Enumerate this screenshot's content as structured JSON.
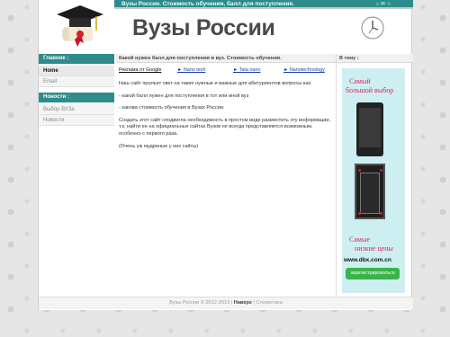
{
  "header": {
    "slogan": "Вузы России. Стоимость обучения, балл для поступления.",
    "title": "Вузы России",
    "top_icons": "⌂ ✉ ☆"
  },
  "sidebar": {
    "main_heading": "Главное :",
    "main_items": [
      {
        "label": "Home",
        "active": true
      },
      {
        "label": "Email",
        "active": false
      }
    ],
    "news_heading": "Новости :",
    "news_items": [
      {
        "label": "Выбор ВУЗа"
      },
      {
        "label": "Новости"
      }
    ]
  },
  "main": {
    "heading": "Какой нужен балл для поступления в вуз. Стоимость обучения.",
    "ad_label": "Реклама от Google",
    "links": [
      "► Nano tech",
      "► Tata nano",
      "► Nanotechnology"
    ],
    "paragraphs": [
      "Наш сайт прольет свет на такие нужные и важные для абитуриентов вопросы как:",
      "- какой балл нужен для поступления в тот или иной вуз",
      "- какова стоимость обучения в Вузах России.",
      "Создать этот сайт сподвигла необходимость в простом виде разместить эту информации, т.к. найти ее на официальных сайтах Вузов не всегда представляется возможным, особенно с первого раза.",
      "(Очень уж мудреные у них сайты)"
    ]
  },
  "right": {
    "heading": "В тему :",
    "ad": {
      "line1": "Самый",
      "line2": "большой выбор",
      "line3": "Самые",
      "line4": "низкие цены",
      "url": "www.dbx.com.cn",
      "button": "зарегистрироваться"
    }
  },
  "footer": {
    "copyright": "Вузы России © 2012-2013 |",
    "link1": "Наверх",
    "sep": "|",
    "link2": "Статистика"
  },
  "colors": {
    "accent": "#2e8b8b",
    "ad_text": "#e0245e",
    "link": "#1a3fa8"
  }
}
